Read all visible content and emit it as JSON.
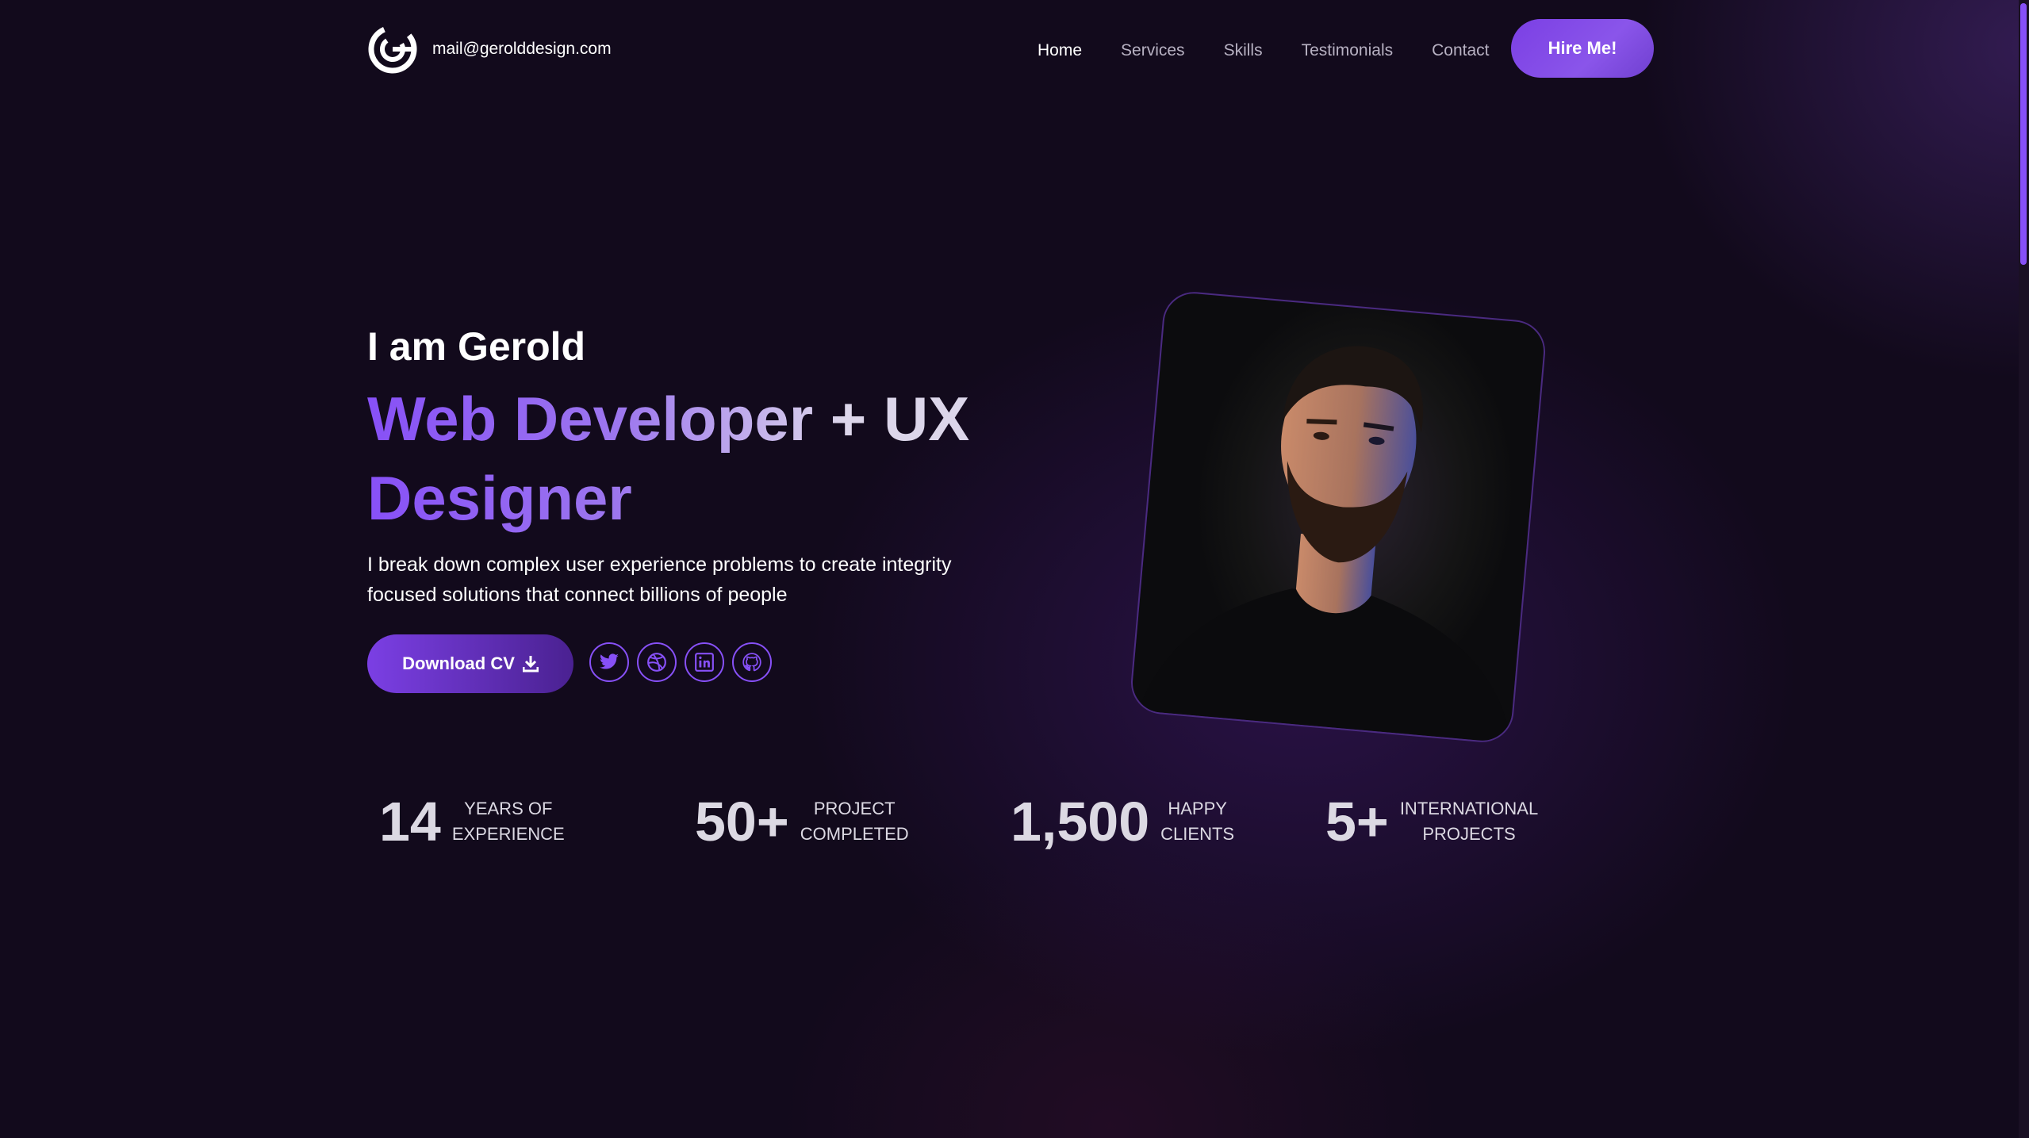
{
  "header": {
    "email": "mail@gerolddesign.com",
    "nav": [
      {
        "label": "Home",
        "active": true
      },
      {
        "label": "Services",
        "active": false
      },
      {
        "label": "Skills",
        "active": false
      },
      {
        "label": "Testimonials",
        "active": false
      },
      {
        "label": "Contact",
        "active": false
      }
    ],
    "hire_label": "Hire Me!"
  },
  "hero": {
    "intro": "I am Gerold",
    "headline": "Web Developer + UX Designer",
    "description": "I break down complex user experience problems to create integrity focused solutions that connect billions of people",
    "cv_label": "Download CV",
    "socials": [
      "twitter-icon",
      "dribbble-icon",
      "linkedin-icon",
      "github-icon"
    ]
  },
  "stats": [
    {
      "number": "14",
      "label1": "YEARS OF",
      "label2": "EXPERIENCE"
    },
    {
      "number": "50+",
      "label1": "PROJECT",
      "label2": "COMPLETED"
    },
    {
      "number": "1,500",
      "label1": "HAPPY",
      "label2": "CLIENTS"
    },
    {
      "number": "5+",
      "label1": "INTERNATIONAL",
      "label2": "PROJECTS"
    }
  ],
  "colors": {
    "accent": "#8750f7",
    "background": "#120a1c"
  }
}
